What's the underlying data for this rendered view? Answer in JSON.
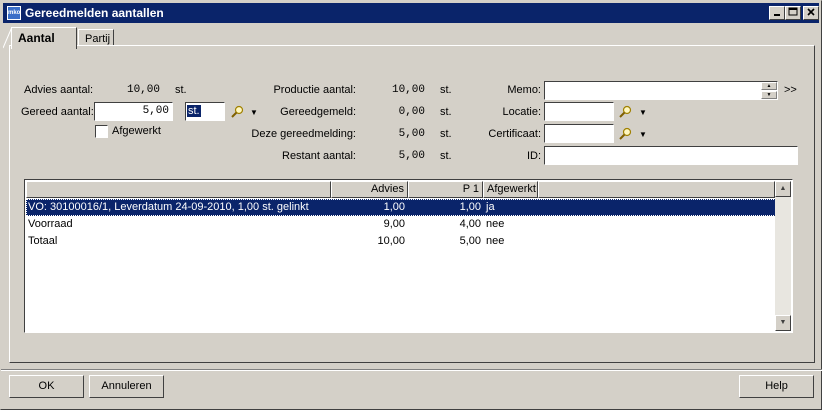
{
  "window": {
    "title": "Gereedmelden aantallen",
    "app_icon_text": "mko"
  },
  "tabs": [
    {
      "label": "Aantal"
    },
    {
      "label": "Partij"
    }
  ],
  "form": {
    "advies_label": "Advies aantal:",
    "advies_value": "10,00",
    "advies_unit": "st.",
    "gereed_label": "Gereed aantal:",
    "gereed_value": "5,00",
    "gereed_unit_value": "st.",
    "afgewerkt_label": "Afgewerkt",
    "afgewerkt_checked": false,
    "productie_label": "Productie aantal:",
    "productie_value": "10,00",
    "productie_unit": "st.",
    "gereedgemeld_label": "Gereedgemeld:",
    "gereedgemeld_value": "0,00",
    "gereedgemeld_unit": "st.",
    "deze_label": "Deze gereedmelding:",
    "deze_value": "5,00",
    "deze_unit": "st.",
    "restant_label": "Restant aantal:",
    "restant_value": "5,00",
    "restant_unit": "st.",
    "memo_label": "Memo:",
    "memo_value": "",
    "memo_more": ">>",
    "locatie_label": "Locatie:",
    "locatie_value": "",
    "certificaat_label": "Certificaat:",
    "certificaat_value": "",
    "id_label": "ID:",
    "id_value": ""
  },
  "grid": {
    "columns": [
      {
        "label": ""
      },
      {
        "label": "Advies"
      },
      {
        "label": "P 1"
      },
      {
        "label": "Afgewerkt"
      },
      {
        "label": ""
      }
    ],
    "rows": [
      {
        "desc": "VO: 30100016/1, Leverdatum 24-09-2010, 1,00 st. gelinkt",
        "advies": "1,00",
        "p1": "1,00",
        "afgewerkt": "ja",
        "selected": true
      },
      {
        "desc": "Voorraad",
        "advies": "9,00",
        "p1": "4,00",
        "afgewerkt": "nee",
        "selected": false
      },
      {
        "desc": "Totaal",
        "advies": "10,00",
        "p1": "5,00",
        "afgewerkt": "nee",
        "selected": false
      }
    ]
  },
  "buttons": {
    "ok": "OK",
    "annuleren": "Annuleren",
    "help": "Help"
  },
  "colors": {
    "titlebar": "#0a246a",
    "face": "#d4d0c8",
    "selection": "#0a246a"
  }
}
